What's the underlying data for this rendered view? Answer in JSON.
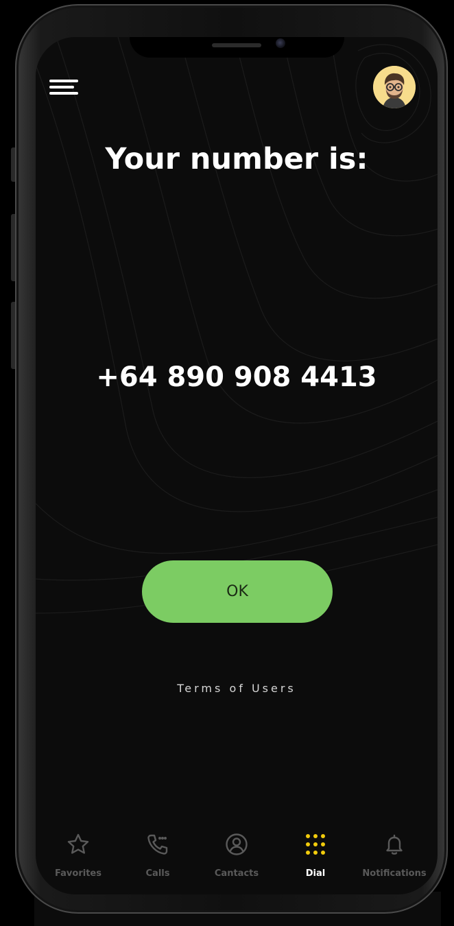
{
  "header": {
    "menu_icon": "hamburger-menu-icon",
    "avatar_icon": "memoji-avatar"
  },
  "main": {
    "title": "Your number is:",
    "phone_number": "+64 890 908 4413",
    "ok_label": "OK",
    "terms_label": "Terms of Users"
  },
  "tabbar": {
    "items": [
      {
        "label": "Favorites",
        "icon": "star-icon",
        "active": false
      },
      {
        "label": "Calls",
        "icon": "phone-icon",
        "active": false
      },
      {
        "label": "Cantacts",
        "icon": "user-circle-icon",
        "active": false
      },
      {
        "label": "Dial",
        "icon": "dialpad-icon",
        "active": true
      },
      {
        "label": "Notifications",
        "icon": "bell-icon",
        "active": false
      }
    ]
  },
  "colors": {
    "background": "#0c0c0c",
    "accent_green": "#7ccc63",
    "active_icon_yellow": "#f2cc0c",
    "inactive_gray": "#5a5a5a",
    "avatar_bg": "#f7dc8c"
  }
}
